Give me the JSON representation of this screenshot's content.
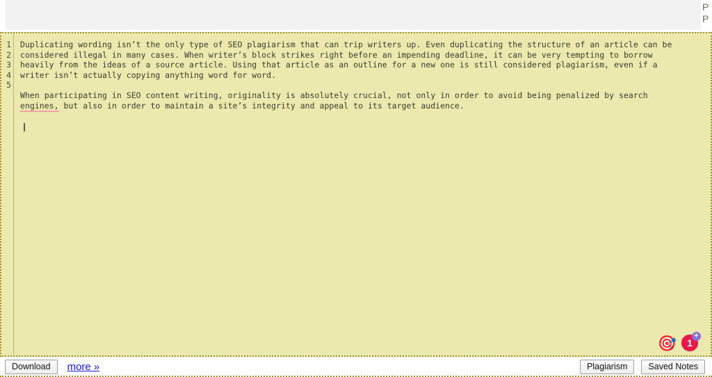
{
  "top_strip": {
    "clipped_text_line1": "P",
    "clipped_text_line2": "P"
  },
  "editor": {
    "gutter_numbers": [
      "1",
      "2",
      "3",
      "4",
      "5"
    ],
    "lines": [
      "Duplicating wording isn’t the only type of SEO plagiarism that can trip writers up. Even duplicating the structure of an article can be",
      "considered illegal in many cases. When writer’s block strikes right before an impending deadline, it can be very tempting to borrow",
      "heavily from the ideas of a source article. Using that article as an outline for a new one is still considered plagiarism, even if a",
      "writer isn’t actually copying anything word for word."
    ],
    "paragraph2_part1": "When participating in SEO content writing, originality is absolutely crucial, not only in order to avoid being penalized by search",
    "paragraph2_spelled_word": "engines,",
    "paragraph2_part2": " but also in order to maintain a site’s integrity and appeal to its target audience.",
    "background_color": "#ece9ae",
    "border_color": "#9a8f2e",
    "spellcheck_underline_color": "#f4a0a8"
  },
  "floating_icons": {
    "target_icon_glyph": "🎯",
    "target_icon_name": "target-dart-icon",
    "badge_count": "1",
    "badge_plus": "+",
    "badge_color": "#e8184a",
    "badge_plus_color": "#8b6fd8"
  },
  "footer": {
    "download_label": "Download",
    "more_label": "more »",
    "plagiarism_label": "Plagiarism",
    "saved_notes_label": "Saved Notes",
    "link_color": "#1414d8"
  }
}
